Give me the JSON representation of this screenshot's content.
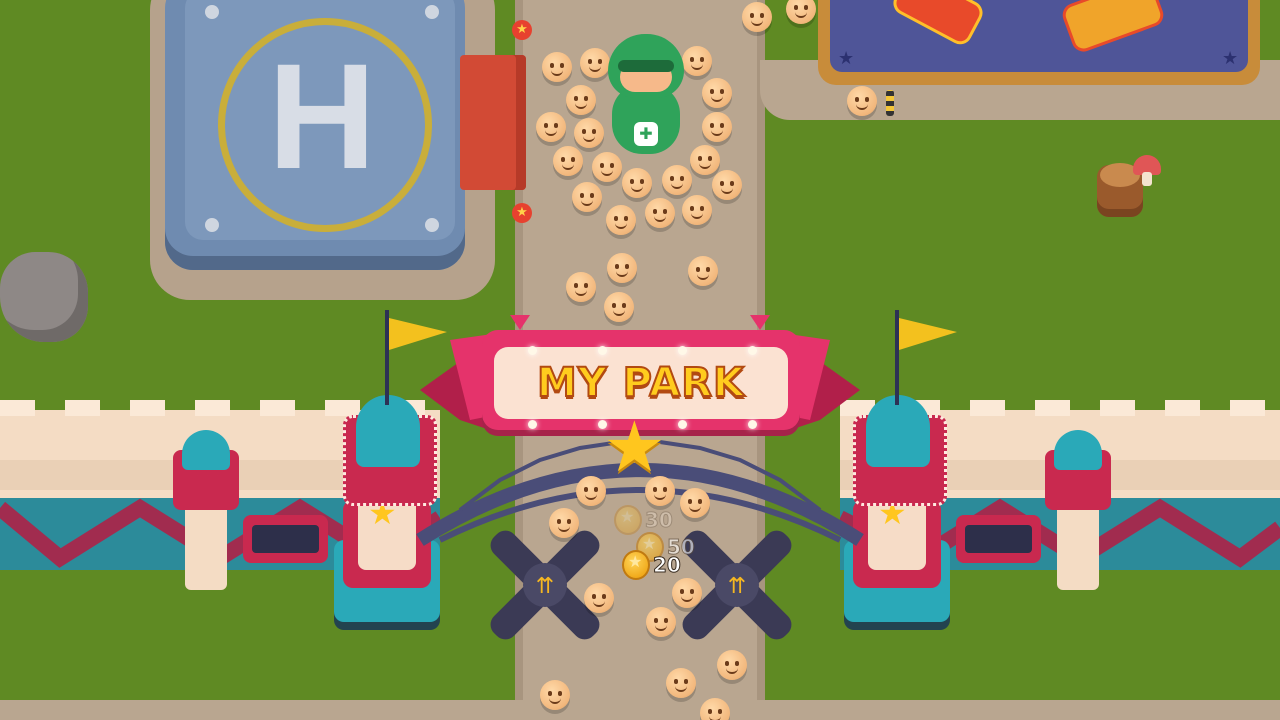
{
  "gate": {
    "title": "MY PARK"
  },
  "helipad": {
    "letter": "H"
  },
  "coin_popups": [
    {
      "value": "30",
      "opacity": 0.35
    },
    {
      "value": "50",
      "opacity": 0.6
    },
    {
      "value": "20",
      "opacity": 1.0
    }
  ],
  "colors": {
    "grass": "#5f8a23",
    "path": "#b8a48f",
    "gate_pink": "#e5336b",
    "wall": "#f4dcc4",
    "teal": "#2aa9b8"
  },
  "icons": [
    "helipad-icon",
    "star-icon",
    "flag-icon",
    "mascot-icon",
    "rock-icon",
    "stump-icon",
    "mushroom-icon",
    "fan-blade-icon",
    "coin-icon"
  ]
}
